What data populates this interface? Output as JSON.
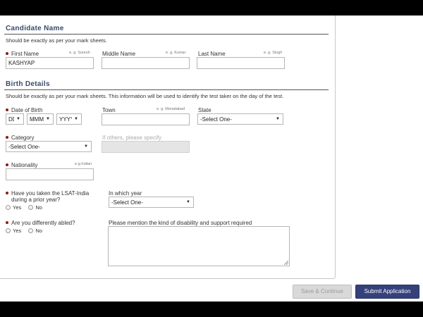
{
  "candidate_name": {
    "title": "Candidate Name",
    "note": "Should be exactly as per your mark sheets.",
    "first_name": {
      "label": "First Name",
      "hint": "e. g. Suresh",
      "value": "KASHYAP"
    },
    "middle_name": {
      "label": "Middle Name",
      "hint": "e. g. Kumar",
      "value": ""
    },
    "last_name": {
      "label": "Last Name",
      "hint": "e. g. Singh",
      "value": ""
    }
  },
  "birth_details": {
    "title": "Birth Details",
    "note": "Should be exactly as per your mark sheets. This information will be used to identify the test taker on the day of the test.",
    "date_of_birth": {
      "label": "Date of Birth",
      "day": "DD",
      "month": "MMM",
      "year": "YYYY"
    },
    "town": {
      "label": "Town",
      "hint": "e. g. Moradabad",
      "value": ""
    },
    "state": {
      "label": "State",
      "value": "-Select One-"
    },
    "category": {
      "label": "Category",
      "value": "-Select One-"
    },
    "others": {
      "label": "If others, please specify",
      "value": ""
    },
    "nationality": {
      "label": "Nationality",
      "hint": "e.g.Indian",
      "value": ""
    },
    "lsat_prior": {
      "label_line1": "Have you taken the LSAT-India",
      "label_line2": "during a prior year?",
      "yes": "Yes",
      "no": "No"
    },
    "which_year": {
      "label": "In which year",
      "value": "-Select One-"
    },
    "differently_abled": {
      "label": "Are you differently abled?",
      "yes": "Yes",
      "no": "No"
    },
    "disability": {
      "label": "Please mention the kind of disability and support required",
      "value": ""
    }
  },
  "actions": {
    "save": "Save & Continue",
    "submit": "Submit Application"
  }
}
